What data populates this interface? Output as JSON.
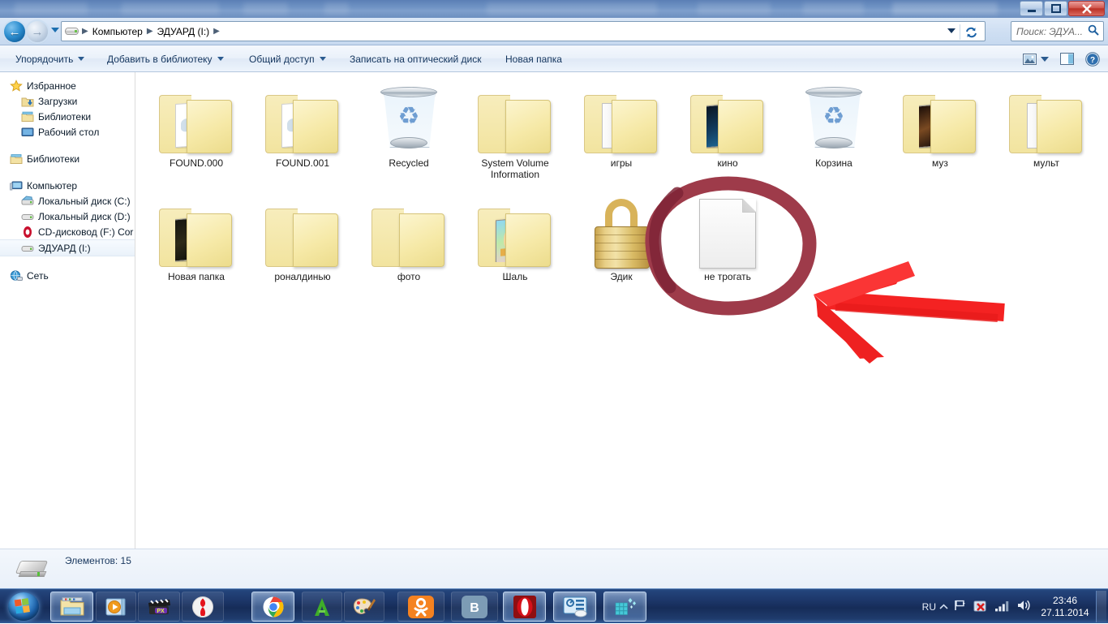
{
  "window": {
    "title_bar_blurred": true,
    "buttons": {
      "minimize": "minimize-button",
      "maximize": "maximize-button",
      "close": "close-button"
    }
  },
  "address_bar": {
    "drive_icon": "drive-icon",
    "crumbs": [
      "Компьютер",
      "ЭДУАРД (I:)"
    ],
    "separator": "▶",
    "dropdown_icon": "chevron-down-icon",
    "refresh_icon": "refresh-icon"
  },
  "search": {
    "placeholder": "Поиск: ЭДУА...",
    "icon": "search-icon"
  },
  "command_bar": {
    "buttons": [
      {
        "label": "Упорядочить",
        "caret": true
      },
      {
        "label": "Добавить в библиотеку",
        "caret": true
      },
      {
        "label": "Общий доступ",
        "caret": true
      },
      {
        "label": "Записать на оптический диск",
        "caret": false
      },
      {
        "label": "Новая папка",
        "caret": false
      }
    ],
    "right_icons": [
      "view-preview-icon",
      "view-dropdown-caret",
      "preview-pane-icon",
      "help-icon"
    ]
  },
  "navigation_pane": {
    "groups": [
      {
        "header": {
          "label": "Избранное",
          "icon": "star-icon"
        },
        "items": [
          {
            "label": "Загрузки",
            "icon": "downloads-folder-icon"
          },
          {
            "label": "Библиотеки",
            "icon": "library-folder-icon"
          },
          {
            "label": "Рабочий стол",
            "icon": "desktop-icon"
          }
        ]
      },
      {
        "header": {
          "label": "Библиотеки",
          "icon": "libraries-icon"
        },
        "items": []
      },
      {
        "header": {
          "label": "Компьютер",
          "icon": "computer-icon"
        },
        "items": [
          {
            "label": "Локальный диск (C:)",
            "icon": "system-drive-icon",
            "selected": false
          },
          {
            "label": "Локальный диск (D:)",
            "icon": "drive-icon",
            "selected": false
          },
          {
            "label": "CD-дисковод (F:) Cor",
            "icon": "cd-drive-icon",
            "selected": false
          },
          {
            "label": "ЭДУАРД (I:)",
            "icon": "drive-icon",
            "selected": true
          }
        ]
      },
      {
        "header": {
          "label": "Сеть",
          "icon": "network-icon"
        },
        "items": []
      }
    ]
  },
  "files": [
    {
      "name": "FOUND.000",
      "type": "folder-docs",
      "col": 0,
      "row": 0
    },
    {
      "name": "FOUND.001",
      "type": "folder-docs",
      "col": 1,
      "row": 0
    },
    {
      "name": "Recycled",
      "type": "recycle-bin",
      "col": 2,
      "row": 0
    },
    {
      "name": "System Volume Information",
      "type": "folder-empty",
      "col": 3,
      "row": 0
    },
    {
      "name": "игры",
      "type": "folder-subfolders",
      "col": 4,
      "row": 0
    },
    {
      "name": "кино",
      "type": "folder-video",
      "col": 5,
      "row": 0
    },
    {
      "name": "Корзина",
      "type": "recycle-bin",
      "col": 6,
      "row": 0
    },
    {
      "name": "муз",
      "type": "folder-media",
      "col": 7,
      "row": 0
    },
    {
      "name": "мульт",
      "type": "folder-subfolders",
      "col": 8,
      "row": 0
    },
    {
      "name": "Новая папка",
      "type": "folder-dark-thumbs",
      "col": 0,
      "row": 1
    },
    {
      "name": "роналдинью",
      "type": "folder-empty",
      "col": 1,
      "row": 1
    },
    {
      "name": "фото",
      "type": "folder-empty",
      "col": 2,
      "row": 1
    },
    {
      "name": "Шаль",
      "type": "folder-picture",
      "col": 3,
      "row": 1
    },
    {
      "name": "Эдик",
      "type": "padlock-file",
      "col": 4,
      "row": 1
    },
    {
      "name": "не трогать",
      "type": "blank-document",
      "col": 5,
      "row": 1,
      "annotated": true
    }
  ],
  "annotations": {
    "circle": {
      "color": "#9e3b4a",
      "target": "не трогать"
    },
    "arrow": {
      "color": "#f42222",
      "direction": "left",
      "points_to": "не трогать"
    }
  },
  "status_bar": {
    "text": "Элементов: 15",
    "icon": "drive-icon"
  },
  "taskbar": {
    "start_button": "start-orb",
    "items": [
      {
        "name": "explorer-taskbar-button",
        "icon": "explorer-icon",
        "active": true
      },
      {
        "name": "media-player-taskbar-button",
        "icon": "wmp-icon",
        "active": false
      },
      {
        "name": "video-editor-taskbar-button",
        "icon": "clapperboard-icon",
        "active": false
      },
      {
        "name": "yandex-browser-taskbar-button",
        "icon": "yandex-icon",
        "active": false
      },
      {
        "name": "chrome-taskbar-button",
        "icon": "chrome-icon",
        "active": false
      },
      {
        "name": "amigo-taskbar-button",
        "icon": "amigo-a-icon",
        "active": false
      },
      {
        "name": "paint-taskbar-button",
        "icon": "paint-palette-icon",
        "active": false
      },
      {
        "name": "odnoklassniki-taskbar-button",
        "icon": "ok-icon",
        "active": false
      },
      {
        "name": "vkontakte-taskbar-button",
        "icon": "vk-icon",
        "active": false
      },
      {
        "name": "opera-taskbar-button",
        "icon": "opera-icon",
        "active": true
      },
      {
        "name": "tuneup-taskbar-button",
        "icon": "tuneup-icon",
        "active": true
      },
      {
        "name": "defrag-taskbar-button",
        "icon": "defrag-cube-icon",
        "active": true
      }
    ],
    "tray": {
      "language": "RU",
      "show_hidden_icon": "chevron-up-icon",
      "icons": [
        "action-flag-icon",
        "antivirus-icon",
        "network-signal-icon",
        "volume-icon"
      ],
      "time": "23:46",
      "date": "27.11.2014",
      "show_desktop": "show-desktop-button"
    }
  }
}
